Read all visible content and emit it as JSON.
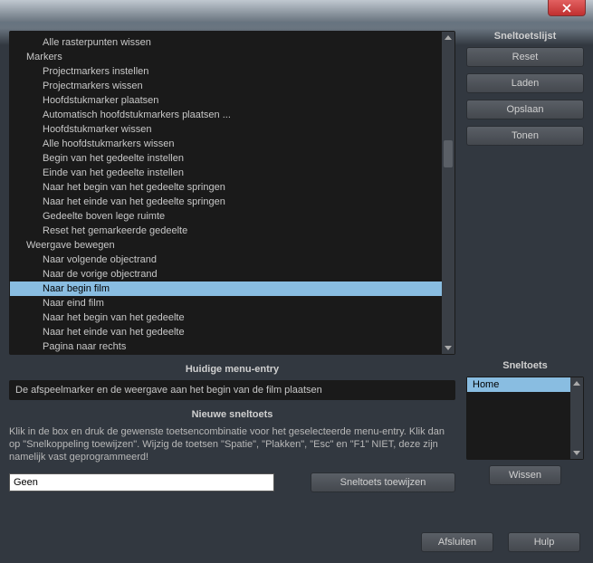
{
  "titlebar": {
    "close": "×"
  },
  "sneltoetslijst": {
    "title": "Sneltoetslijst",
    "reset": "Reset",
    "laden": "Laden",
    "opslaan": "Opslaan",
    "tonen": "Tonen"
  },
  "menu_list": {
    "items": [
      {
        "label": "Alle rasterpunten wissen",
        "indent": true
      },
      {
        "label": "Markers",
        "indent": false
      },
      {
        "label": "Projectmarkers instellen",
        "indent": true
      },
      {
        "label": "Projectmarkers wissen",
        "indent": true
      },
      {
        "label": "Hoofdstukmarker plaatsen",
        "indent": true
      },
      {
        "label": "Automatisch hoofdstukmarkers plaatsen ...",
        "indent": true
      },
      {
        "label": "Hoofdstukmarker wissen",
        "indent": true
      },
      {
        "label": "Alle hoofdstukmarkers wissen",
        "indent": true
      },
      {
        "label": "Begin van het gedeelte instellen",
        "indent": true
      },
      {
        "label": "Einde van het gedeelte instellen",
        "indent": true
      },
      {
        "label": "Naar het begin van het gedeelte springen",
        "indent": true
      },
      {
        "label": "Naar het einde van het gedeelte springen",
        "indent": true
      },
      {
        "label": "Gedeelte boven lege ruimte",
        "indent": true
      },
      {
        "label": "Reset het gemarkeerde gedeelte",
        "indent": true
      },
      {
        "label": "Weergave bewegen",
        "indent": false
      },
      {
        "label": "Naar volgende objectrand",
        "indent": true
      },
      {
        "label": "Naar de vorige objectrand",
        "indent": true
      },
      {
        "label": "Naar begin film",
        "indent": true,
        "selected": true
      },
      {
        "label": "Naar eind film",
        "indent": true
      },
      {
        "label": "Naar het begin van het gedeelte",
        "indent": true
      },
      {
        "label": "Naar het einde van het gedeelte",
        "indent": true
      },
      {
        "label": "Pagina naar rechts",
        "indent": true
      }
    ]
  },
  "current_entry": {
    "title": "Huidige menu-entry",
    "value": "De afspeelmarker en de weergave aan het begin van de film plaatsen"
  },
  "new_shortcut": {
    "title": "Nieuwe sneltoets",
    "help": "Klik in de box en druk de gewenste toetsencombinatie voor het geselecteerde menu-entry. Klik dan op \"Snelkoppeling toewijzen\". Wijzig de toetsen \"Spatie\", \"Plakken\", \"Esc\" en \"F1\" NIET, deze zijn namelijk vast geprogrammeerd!",
    "input_value": "Geen",
    "assign": "Sneltoets toewijzen"
  },
  "sneltoets": {
    "title": "Sneltoets",
    "items": [
      "Home"
    ],
    "wissen": "Wissen"
  },
  "footer": {
    "afsluiten": "Afsluiten",
    "hulp": "Hulp"
  }
}
